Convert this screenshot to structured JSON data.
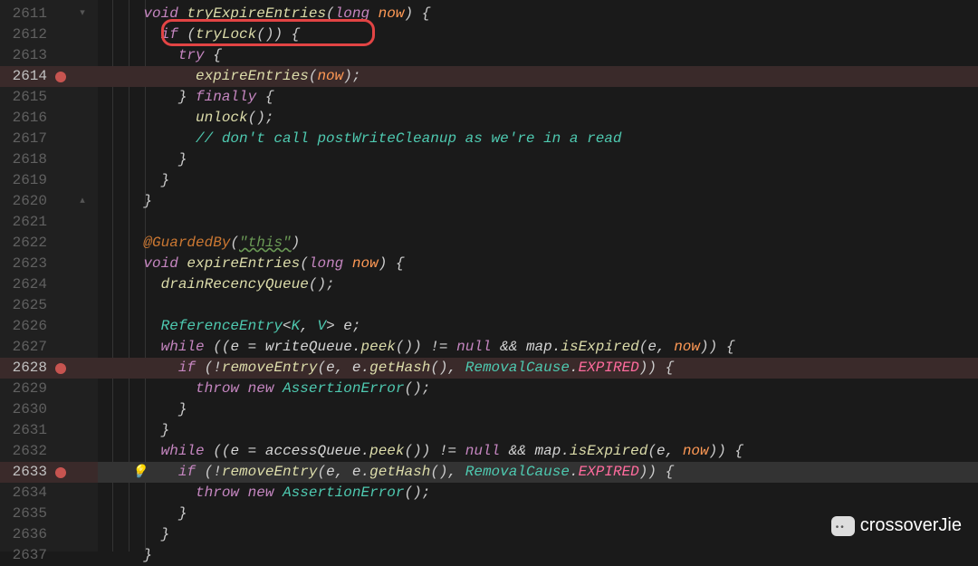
{
  "watermark": "crossoverJie",
  "first_line_number": 2611,
  "highlight_lines": [
    2614,
    2628,
    2633
  ],
  "current_line": 2633,
  "breakpoints": [
    2614,
    2628,
    2633
  ],
  "lightbulb_line": 2633,
  "fold_markers": {
    "2611": "open",
    "2620": "close"
  },
  "red_box_line": 2612,
  "lines": [
    {
      "n": 2611,
      "indent": 2,
      "tokens": [
        [
          "kw",
          "void"
        ],
        [
          "id",
          " "
        ],
        [
          "mth",
          "tryExpireEntries"
        ],
        [
          "pun",
          "("
        ],
        [
          "kw",
          "long"
        ],
        [
          "id",
          " "
        ],
        [
          "param",
          "now"
        ],
        [
          "pun",
          ") {"
        ]
      ]
    },
    {
      "n": 2612,
      "indent": 3,
      "tokens": [
        [
          "kw",
          "if"
        ],
        [
          "id",
          " "
        ],
        [
          "pun",
          "("
        ],
        [
          "mth",
          "tryLock"
        ],
        [
          "pun",
          "()) {"
        ]
      ]
    },
    {
      "n": 2613,
      "indent": 4,
      "tokens": [
        [
          "kw",
          "try"
        ],
        [
          "id",
          " "
        ],
        [
          "pun",
          "{"
        ]
      ]
    },
    {
      "n": 2614,
      "indent": 5,
      "tokens": [
        [
          "mth",
          "expireEntries"
        ],
        [
          "pun",
          "("
        ],
        [
          "param",
          "now"
        ],
        [
          "pun",
          ");"
        ]
      ]
    },
    {
      "n": 2615,
      "indent": 4,
      "tokens": [
        [
          "pun",
          "} "
        ],
        [
          "kw",
          "finally"
        ],
        [
          "id",
          " "
        ],
        [
          "pun",
          "{"
        ]
      ]
    },
    {
      "n": 2616,
      "indent": 5,
      "tokens": [
        [
          "mth",
          "unlock"
        ],
        [
          "pun",
          "();"
        ]
      ]
    },
    {
      "n": 2617,
      "indent": 5,
      "tokens": [
        [
          "cmt",
          "// don't call postWriteCleanup as we're in a read"
        ]
      ]
    },
    {
      "n": 2618,
      "indent": 4,
      "tokens": [
        [
          "pun",
          "}"
        ]
      ]
    },
    {
      "n": 2619,
      "indent": 3,
      "tokens": [
        [
          "pun",
          "}"
        ]
      ]
    },
    {
      "n": 2620,
      "indent": 2,
      "tokens": [
        [
          "pun",
          "}"
        ]
      ]
    },
    {
      "n": 2621,
      "indent": 0,
      "tokens": []
    },
    {
      "n": 2622,
      "indent": 2,
      "tokens": [
        [
          "ann",
          "@GuardedBy"
        ],
        [
          "pun",
          "("
        ],
        [
          "annstr",
          "\"this\""
        ],
        [
          "pun",
          ")"
        ]
      ]
    },
    {
      "n": 2623,
      "indent": 2,
      "tokens": [
        [
          "kw",
          "void"
        ],
        [
          "id",
          " "
        ],
        [
          "mth",
          "expireEntries"
        ],
        [
          "pun",
          "("
        ],
        [
          "kw",
          "long"
        ],
        [
          "id",
          " "
        ],
        [
          "param",
          "now"
        ],
        [
          "pun",
          ") {"
        ]
      ]
    },
    {
      "n": 2624,
      "indent": 3,
      "tokens": [
        [
          "mth",
          "drainRecencyQueue"
        ],
        [
          "pun",
          "();"
        ]
      ]
    },
    {
      "n": 2625,
      "indent": 0,
      "tokens": []
    },
    {
      "n": 2626,
      "indent": 3,
      "tokens": [
        [
          "type",
          "ReferenceEntry"
        ],
        [
          "pun",
          "<"
        ],
        [
          "type",
          "K"
        ],
        [
          "pun",
          ", "
        ],
        [
          "type",
          "V"
        ],
        [
          "pun",
          "> "
        ],
        [
          "id",
          "e"
        ],
        [
          "pun",
          ";"
        ]
      ]
    },
    {
      "n": 2627,
      "indent": 3,
      "tokens": [
        [
          "kw",
          "while"
        ],
        [
          "id",
          " "
        ],
        [
          "pun",
          "(("
        ],
        [
          "id",
          "e"
        ],
        [
          "op",
          " = "
        ],
        [
          "id",
          "writeQueue"
        ],
        [
          "pun",
          "."
        ],
        [
          "mth",
          "peek"
        ],
        [
          "pun",
          "()) "
        ],
        [
          "op",
          "!="
        ],
        [
          "id",
          " "
        ],
        [
          "kw",
          "null"
        ],
        [
          "id",
          " "
        ],
        [
          "op",
          "&&"
        ],
        [
          "id",
          " "
        ],
        [
          "id",
          "map"
        ],
        [
          "pun",
          "."
        ],
        [
          "mth",
          "isExpired"
        ],
        [
          "pun",
          "("
        ],
        [
          "id",
          "e"
        ],
        [
          "pun",
          ", "
        ],
        [
          "param",
          "now"
        ],
        [
          "pun",
          ")) {"
        ]
      ]
    },
    {
      "n": 2628,
      "indent": 4,
      "tokens": [
        [
          "kw",
          "if"
        ],
        [
          "id",
          " "
        ],
        [
          "pun",
          "("
        ],
        [
          "op",
          "!"
        ],
        [
          "mth",
          "removeEntry"
        ],
        [
          "pun",
          "("
        ],
        [
          "id",
          "e"
        ],
        [
          "pun",
          ", "
        ],
        [
          "id",
          "e"
        ],
        [
          "pun",
          "."
        ],
        [
          "mth",
          "getHash"
        ],
        [
          "pun",
          "(), "
        ],
        [
          "type",
          "RemovalCause"
        ],
        [
          "pun",
          "."
        ],
        [
          "const",
          "EXPIRED"
        ],
        [
          "pun",
          ")) {"
        ]
      ]
    },
    {
      "n": 2629,
      "indent": 5,
      "tokens": [
        [
          "kw",
          "throw"
        ],
        [
          "id",
          " "
        ],
        [
          "kw",
          "new"
        ],
        [
          "id",
          " "
        ],
        [
          "type",
          "AssertionError"
        ],
        [
          "pun",
          "();"
        ]
      ]
    },
    {
      "n": 2630,
      "indent": 4,
      "tokens": [
        [
          "pun",
          "}"
        ]
      ]
    },
    {
      "n": 2631,
      "indent": 3,
      "tokens": [
        [
          "pun",
          "}"
        ]
      ]
    },
    {
      "n": 2632,
      "indent": 3,
      "tokens": [
        [
          "kw",
          "while"
        ],
        [
          "id",
          " "
        ],
        [
          "pun",
          "(("
        ],
        [
          "id",
          "e"
        ],
        [
          "op",
          " = "
        ],
        [
          "id",
          "accessQueue"
        ],
        [
          "pun",
          "."
        ],
        [
          "mth",
          "peek"
        ],
        [
          "pun",
          "()) "
        ],
        [
          "op",
          "!="
        ],
        [
          "id",
          " "
        ],
        [
          "kw",
          "null"
        ],
        [
          "id",
          " "
        ],
        [
          "op",
          "&&"
        ],
        [
          "id",
          " "
        ],
        [
          "id",
          "map"
        ],
        [
          "pun",
          "."
        ],
        [
          "mth",
          "isExpired"
        ],
        [
          "pun",
          "("
        ],
        [
          "id",
          "e"
        ],
        [
          "pun",
          ", "
        ],
        [
          "param",
          "now"
        ],
        [
          "pun",
          ")) {"
        ]
      ]
    },
    {
      "n": 2633,
      "indent": 4,
      "tokens": [
        [
          "kw",
          "if"
        ],
        [
          "id",
          " "
        ],
        [
          "pun",
          "("
        ],
        [
          "op",
          "!"
        ],
        [
          "mth",
          "removeEntry"
        ],
        [
          "pun",
          "("
        ],
        [
          "id",
          "e"
        ],
        [
          "pun",
          ", "
        ],
        [
          "id",
          "e"
        ],
        [
          "pun",
          "."
        ],
        [
          "mth",
          "getHash"
        ],
        [
          "pun",
          "(), "
        ],
        [
          "type",
          "RemovalCause"
        ],
        [
          "pun",
          "."
        ],
        [
          "const",
          "EXPIRED"
        ],
        [
          "pun",
          ")) {"
        ]
      ]
    },
    {
      "n": 2634,
      "indent": 5,
      "tokens": [
        [
          "kw",
          "throw"
        ],
        [
          "id",
          " "
        ],
        [
          "kw",
          "new"
        ],
        [
          "id",
          " "
        ],
        [
          "type",
          "AssertionError"
        ],
        [
          "pun",
          "();"
        ]
      ]
    },
    {
      "n": 2635,
      "indent": 4,
      "tokens": [
        [
          "pun",
          "}"
        ]
      ]
    },
    {
      "n": 2636,
      "indent": 3,
      "tokens": [
        [
          "pun",
          "}"
        ]
      ]
    },
    {
      "n": 2637,
      "indent": 2,
      "tokens": [
        [
          "pun",
          "}"
        ]
      ]
    }
  ]
}
